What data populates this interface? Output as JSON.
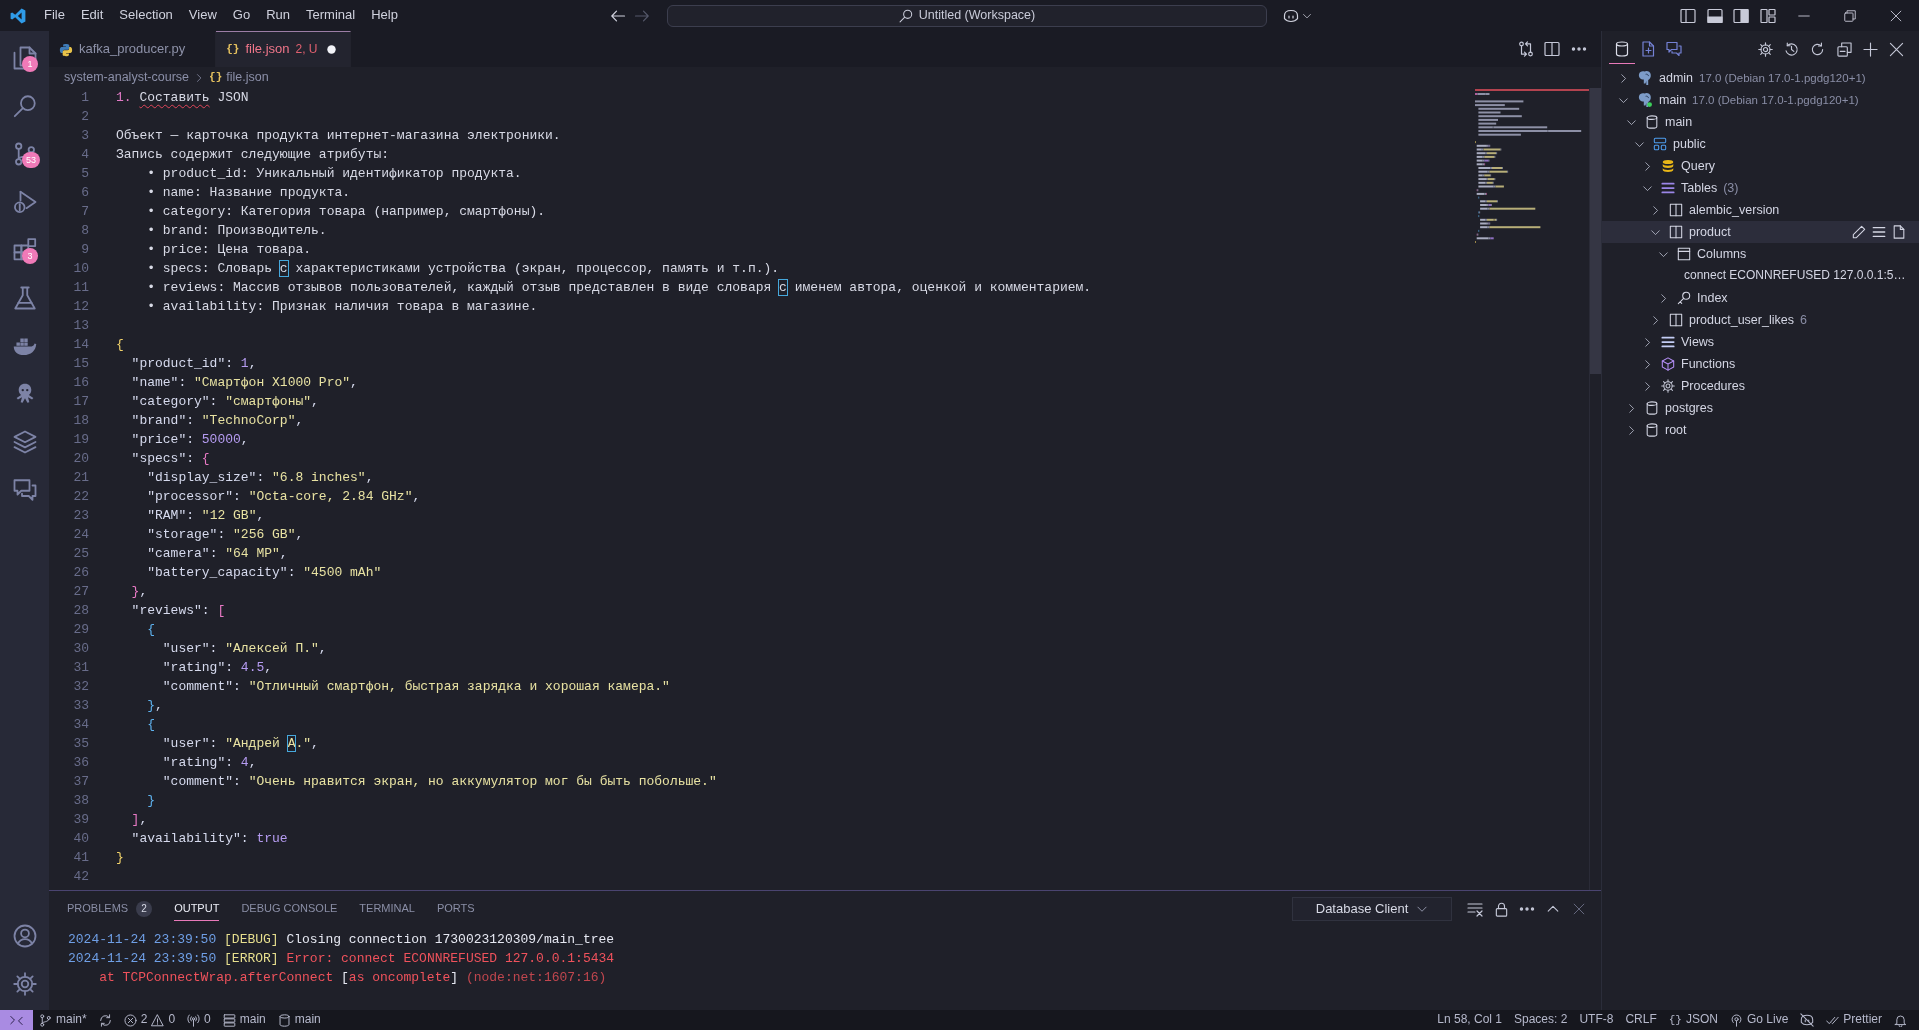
{
  "title_bar": {
    "menu": [
      "File",
      "Edit",
      "Selection",
      "View",
      "Go",
      "Run",
      "Terminal",
      "Help"
    ],
    "navigation": [
      {
        "kind": "back",
        "disabled": false
      },
      {
        "kind": "forward",
        "disabled": true
      }
    ],
    "command_center": "Untitled (Workspace)",
    "layout_controls": [
      {
        "kind": "primary-sidebar",
        "on": false
      },
      {
        "kind": "panel",
        "on": true
      },
      {
        "kind": "secondary-sidebar",
        "on": true
      },
      {
        "kind": "customize"
      }
    ]
  },
  "activity_bar": {
    "items": [
      {
        "kind": "explorer",
        "badge": "1"
      },
      {
        "kind": "search"
      },
      {
        "kind": "source-control",
        "badge": "53"
      },
      {
        "kind": "run-debug"
      },
      {
        "kind": "extensions",
        "badge": "3"
      },
      {
        "kind": "testing"
      },
      {
        "kind": "docker"
      },
      {
        "kind": "octopus"
      },
      {
        "kind": "layers"
      },
      {
        "kind": "chat"
      }
    ],
    "bottom_items": [
      {
        "kind": "account"
      },
      {
        "kind": "settings"
      }
    ]
  },
  "editor": {
    "tabs": [
      {
        "label": "kafka_producer.py",
        "kind": "python",
        "selected": false,
        "problems": false,
        "modified": false
      },
      {
        "label": "file.json",
        "kind": "json",
        "icon": "{}",
        "status": "2, U",
        "selected": true,
        "problems": true,
        "modified": true
      }
    ],
    "breadcrumbs": [
      {
        "label": "system-analyst-course",
        "kind": "folder"
      },
      {
        "label": "file.json",
        "kind": "json",
        "icon": "{}"
      }
    ],
    "lines": [
      {
        "number": "1",
        "tokens": [
          {
            "text": "1. ",
            "kind": "list-number"
          },
          {
            "text": "Составить",
            "kind": "text",
            "misspelled": true
          },
          {
            "text": " JSON",
            "kind": "text"
          }
        ]
      },
      {
        "number": "2"
      },
      {
        "number": "3",
        "tokens": [
          {
            "text": "Объект — карточка продукта интернет-магазина электроники.",
            "kind": "text"
          }
        ]
      },
      {
        "number": "4",
        "tokens": [
          {
            "text": "Запись содержит следующие атрибуты:",
            "kind": "text"
          }
        ]
      },
      {
        "number": "5",
        "tokens": [
          {
            "text": "    • product_id: Уникальный идентификатор продукта.",
            "kind": "text"
          }
        ]
      },
      {
        "number": "6",
        "tokens": [
          {
            "text": "    • name: Название продукта.",
            "kind": "text"
          }
        ]
      },
      {
        "number": "7",
        "tokens": [
          {
            "text": "    • category: Категория товара (например, смартфоны).",
            "kind": "text"
          }
        ]
      },
      {
        "number": "8",
        "tokens": [
          {
            "text": "    • brand: Производитель.",
            "kind": "text"
          }
        ]
      },
      {
        "number": "9",
        "tokens": [
          {
            "text": "    • price: Цена товара.",
            "kind": "text"
          }
        ]
      },
      {
        "number": "10",
        "tokens": [
          {
            "text": "    • specs: Словарь ",
            "kind": "text"
          },
          {
            "text": "с",
            "kind": "text",
            "ambiguous": true
          },
          {
            "text": " характеристиками устройства (экран, процессор, память и т.п.).",
            "kind": "text"
          }
        ]
      },
      {
        "number": "11",
        "tokens": [
          {
            "text": "    • reviews: Массив отзывов пользователей, каждый отзыв представлен в виде словаря ",
            "kind": "text"
          },
          {
            "text": "с",
            "kind": "text",
            "ambiguous": true
          },
          {
            "text": " именем автора, оценкой и комментарием.",
            "kind": "text"
          }
        ]
      },
      {
        "number": "12",
        "tokens": [
          {
            "text": "    • availability: Признак наличия товара в магазине.",
            "kind": "text"
          }
        ]
      },
      {
        "number": "13"
      },
      {
        "number": "14",
        "tokens": [
          {
            "text": "{",
            "kind": "bracket-outer"
          }
        ]
      },
      {
        "number": "15",
        "tokens": [
          {
            "text": "  \"product_id\"",
            "kind": "key"
          },
          {
            "text": ": ",
            "kind": "punctuation"
          },
          {
            "text": "1",
            "kind": "number"
          },
          {
            "text": ",",
            "kind": "punctuation"
          }
        ]
      },
      {
        "number": "16",
        "tokens": [
          {
            "text": "  \"name\"",
            "kind": "key"
          },
          {
            "text": ": ",
            "kind": "punctuation"
          },
          {
            "text": "\"Смартфон X1000 Pro\"",
            "kind": "string"
          },
          {
            "text": ",",
            "kind": "punctuation"
          }
        ]
      },
      {
        "number": "17",
        "tokens": [
          {
            "text": "  \"category\"",
            "kind": "key"
          },
          {
            "text": ": ",
            "kind": "punctuation"
          },
          {
            "text": "\"смартфоны\"",
            "kind": "string"
          },
          {
            "text": ",",
            "kind": "punctuation"
          }
        ]
      },
      {
        "number": "18",
        "tokens": [
          {
            "text": "  \"brand\"",
            "kind": "key"
          },
          {
            "text": ": ",
            "kind": "punctuation"
          },
          {
            "text": "\"TechnoCorp\"",
            "kind": "string"
          },
          {
            "text": ",",
            "kind": "punctuation"
          }
        ]
      },
      {
        "number": "19",
        "tokens": [
          {
            "text": "  \"price\"",
            "kind": "key"
          },
          {
            "text": ": ",
            "kind": "punctuation"
          },
          {
            "text": "50000",
            "kind": "number"
          },
          {
            "text": ",",
            "kind": "punctuation"
          }
        ]
      },
      {
        "number": "20",
        "tokens": [
          {
            "text": "  \"specs\"",
            "kind": "key"
          },
          {
            "text": ": ",
            "kind": "punctuation"
          },
          {
            "text": "{",
            "kind": "bracket-middle"
          }
        ]
      },
      {
        "number": "21",
        "tokens": [
          {
            "text": "    \"display_size\"",
            "kind": "key"
          },
          {
            "text": ": ",
            "kind": "punctuation"
          },
          {
            "text": "\"6.8 inches\"",
            "kind": "string"
          },
          {
            "text": ",",
            "kind": "punctuation"
          }
        ]
      },
      {
        "number": "22",
        "tokens": [
          {
            "text": "    \"processor\"",
            "kind": "key"
          },
          {
            "text": ": ",
            "kind": "punctuation"
          },
          {
            "text": "\"Octa-core, 2.84 GHz\"",
            "kind": "string"
          },
          {
            "text": ",",
            "kind": "punctuation"
          }
        ]
      },
      {
        "number": "23",
        "tokens": [
          {
            "text": "    \"RAM\"",
            "kind": "key"
          },
          {
            "text": ": ",
            "kind": "punctuation"
          },
          {
            "text": "\"12 GB\"",
            "kind": "string"
          },
          {
            "text": ",",
            "kind": "punctuation"
          }
        ]
      },
      {
        "number": "24",
        "tokens": [
          {
            "text": "    \"storage\"",
            "kind": "key"
          },
          {
            "text": ": ",
            "kind": "punctuation"
          },
          {
            "text": "\"256 GB\"",
            "kind": "string"
          },
          {
            "text": ",",
            "kind": "punctuation"
          }
        ]
      },
      {
        "number": "25",
        "tokens": [
          {
            "text": "    \"camera\"",
            "kind": "key"
          },
          {
            "text": ": ",
            "kind": "punctuation"
          },
          {
            "text": "\"64 MP\"",
            "kind": "string"
          },
          {
            "text": ",",
            "kind": "punctuation"
          }
        ]
      },
      {
        "number": "26",
        "tokens": [
          {
            "text": "    \"battery_capacity\"",
            "kind": "key"
          },
          {
            "text": ": ",
            "kind": "punctuation"
          },
          {
            "text": "\"4500 mAh\"",
            "kind": "string"
          }
        ]
      },
      {
        "number": "27",
        "tokens": [
          {
            "text": "  }",
            "kind": "bracket-middle"
          },
          {
            "text": ",",
            "kind": "punctuation"
          }
        ]
      },
      {
        "number": "28",
        "tokens": [
          {
            "text": "  \"reviews\"",
            "kind": "key"
          },
          {
            "text": ": ",
            "kind": "punctuation"
          },
          {
            "text": "[",
            "kind": "bracket-middle"
          }
        ]
      },
      {
        "number": "29",
        "tokens": [
          {
            "text": "    {",
            "kind": "bracket-inner"
          }
        ]
      },
      {
        "number": "30",
        "tokens": [
          {
            "text": "      \"user\"",
            "kind": "key"
          },
          {
            "text": ": ",
            "kind": "punctuation"
          },
          {
            "text": "\"Алексей П.\"",
            "kind": "string"
          },
          {
            "text": ",",
            "kind": "punctuation"
          }
        ]
      },
      {
        "number": "31",
        "tokens": [
          {
            "text": "      \"rating\"",
            "kind": "key"
          },
          {
            "text": ": ",
            "kind": "punctuation"
          },
          {
            "text": "4.5",
            "kind": "number"
          },
          {
            "text": ",",
            "kind": "punctuation"
          }
        ]
      },
      {
        "number": "32",
        "tokens": [
          {
            "text": "      \"comment\"",
            "kind": "key"
          },
          {
            "text": ": ",
            "kind": "punctuation"
          },
          {
            "text": "\"Отличный смартфон, быстрая зарядка и хорошая камера.\"",
            "kind": "string"
          }
        ]
      },
      {
        "number": "33",
        "tokens": [
          {
            "text": "    }",
            "kind": "bracket-inner"
          },
          {
            "text": ",",
            "kind": "punctuation"
          }
        ]
      },
      {
        "number": "34",
        "tokens": [
          {
            "text": "    {",
            "kind": "bracket-inner"
          }
        ]
      },
      {
        "number": "35",
        "tokens": [
          {
            "text": "      \"user\"",
            "kind": "key"
          },
          {
            "text": ": ",
            "kind": "punctuation"
          },
          {
            "text": "\"Андрей ",
            "kind": "string"
          },
          {
            "text": "А",
            "kind": "string",
            "ambiguous": true
          },
          {
            "text": ".\"",
            "kind": "string"
          },
          {
            "text": ",",
            "kind": "punctuation"
          }
        ]
      },
      {
        "number": "36",
        "tokens": [
          {
            "text": "      \"rating\"",
            "kind": "key"
          },
          {
            "text": ": ",
            "kind": "punctuation"
          },
          {
            "text": "4",
            "kind": "number"
          },
          {
            "text": ",",
            "kind": "punctuation"
          }
        ]
      },
      {
        "number": "37",
        "tokens": [
          {
            "text": "      \"comment\"",
            "kind": "key"
          },
          {
            "text": ": ",
            "kind": "punctuation"
          },
          {
            "text": "\"Очень нравится экран, но аккумулятор мог бы быть побольше.\"",
            "kind": "string"
          }
        ]
      },
      {
        "number": "38",
        "tokens": [
          {
            "text": "    }",
            "kind": "bracket-inner"
          }
        ]
      },
      {
        "number": "39",
        "tokens": [
          {
            "text": "  ]",
            "kind": "bracket-middle"
          },
          {
            "text": ",",
            "kind": "punctuation"
          }
        ]
      },
      {
        "number": "40",
        "tokens": [
          {
            "text": "  \"availability\"",
            "kind": "key"
          },
          {
            "text": ": ",
            "kind": "punctuation"
          },
          {
            "text": "true",
            "kind": "boolean"
          }
        ]
      },
      {
        "number": "41",
        "tokens": [
          {
            "text": "}",
            "kind": "bracket-outer"
          }
        ]
      },
      {
        "number": "42"
      }
    ]
  },
  "panel": {
    "tabs": [
      {
        "label": "PROBLEMS",
        "badge": "2",
        "selected": false
      },
      {
        "label": "OUTPUT",
        "selected": true
      },
      {
        "label": "DEBUG CONSOLE",
        "selected": false
      },
      {
        "label": "TERMINAL",
        "selected": false
      },
      {
        "label": "PORTS",
        "selected": false
      }
    ],
    "output_channel": "Database Client",
    "output_lines": [
      {
        "tokens": [
          {
            "text": "2024-11-24 23:39:50",
            "kind": "timestamp"
          },
          {
            "text": " [DEBUG]",
            "kind": "level"
          },
          {
            "text": " Closing connection 1730023120309/main_tree",
            "kind": "message"
          }
        ]
      },
      {
        "tokens": [
          {
            "text": "2024-11-24 23:39:50",
            "kind": "timestamp"
          },
          {
            "text": " [ERROR]",
            "kind": "level"
          },
          {
            "text": " Error: connect ECONNREFUSED 127.0.0.1:5434",
            "kind": "error"
          }
        ]
      },
      {
        "tokens": [
          {
            "text": "    at TCPConnectWrap.afterConnect ",
            "kind": "error"
          },
          {
            "text": "[",
            "kind": "message"
          },
          {
            "text": "as oncomplete",
            "kind": "error"
          },
          {
            "text": "]",
            "kind": "message"
          },
          {
            "text": " (node:net:1607:16)",
            "kind": "trace"
          }
        ]
      }
    ]
  },
  "secondary_sidebar": {
    "views": [
      {
        "kind": "database",
        "selected": true
      },
      {
        "kind": "file",
        "selected": false
      },
      {
        "kind": "chat",
        "selected": false
      }
    ],
    "tree": [
      {
        "label": "admin",
        "description": "17.0 (Debian 17.0-1.pgdg120+1)",
        "kind": "connection",
        "connected": false,
        "expanded": false,
        "selected": false
      },
      {
        "label": "main",
        "description": "17.0 (Debian 17.0-1.pgdg120+1)",
        "kind": "connection",
        "connected": true,
        "expanded": true,
        "selected": false,
        "children": [
          {
            "label": "main",
            "kind": "database",
            "expanded": true,
            "selected": false,
            "children": [
              {
                "label": "public",
                "kind": "schema",
                "expanded": true,
                "selected": false,
                "children": [
                  {
                    "label": "Query",
                    "kind": "query",
                    "expanded": false,
                    "selected": false
                  },
                  {
                    "label": "Tables",
                    "count": "(3)",
                    "kind": "tables",
                    "expanded": true,
                    "selected": false,
                    "children": [
                      {
                        "label": "alembic_version",
                        "kind": "table",
                        "expanded": false,
                        "selected": false
                      },
                      {
                        "label": "product",
                        "kind": "table",
                        "expanded": true,
                        "selected": true,
                        "children": [
                          {
                            "label": "Columns",
                            "kind": "columns",
                            "expanded": true,
                            "selected": false,
                            "children": [
                              {
                                "label": "connect ECONNREFUSED 127.0.0.1:5…",
                                "kind": "message",
                                "selected": false
                              }
                            ]
                          },
                          {
                            "label": "Index",
                            "kind": "index",
                            "expanded": false,
                            "selected": false
                          }
                        ]
                      },
                      {
                        "label": "product_user_likes",
                        "count": "6",
                        "kind": "table",
                        "expanded": false,
                        "selected": false
                      }
                    ]
                  },
                  {
                    "label": "Views",
                    "kind": "views",
                    "expanded": false,
                    "selected": false
                  },
                  {
                    "label": "Functions",
                    "kind": "functions",
                    "expanded": false,
                    "selected": false
                  },
                  {
                    "label": "Procedures",
                    "kind": "procedures",
                    "expanded": false,
                    "selected": false
                  }
                ]
              }
            ]
          },
          {
            "label": "postgres",
            "kind": "database",
            "expanded": false,
            "selected": false
          },
          {
            "label": "root",
            "kind": "database",
            "expanded": false,
            "selected": false
          }
        ]
      }
    ]
  },
  "status_bar": {
    "left": [
      {
        "kind": "remote"
      },
      {
        "kind": "branch",
        "text": "main*"
      },
      {
        "kind": "sync"
      },
      {
        "kind": "problems",
        "errors": "2",
        "warnings": "0"
      },
      {
        "kind": "ports",
        "text": "0"
      },
      {
        "kind": "connection",
        "text": "main"
      },
      {
        "kind": "database",
        "text": "main"
      }
    ],
    "right": [
      {
        "kind": "text",
        "text": "Ln 58, Col 1"
      },
      {
        "kind": "text",
        "text": "Spaces: 2"
      },
      {
        "kind": "text",
        "text": "UTF-8"
      },
      {
        "kind": "text",
        "text": "CRLF"
      },
      {
        "kind": "language",
        "icon": "{}",
        "text": "JSON"
      },
      {
        "kind": "go-live",
        "text": "Go Live"
      },
      {
        "kind": "copilot"
      },
      {
        "kind": "prettier",
        "text": "Prettier"
      },
      {
        "kind": "notifications"
      }
    ]
  }
}
